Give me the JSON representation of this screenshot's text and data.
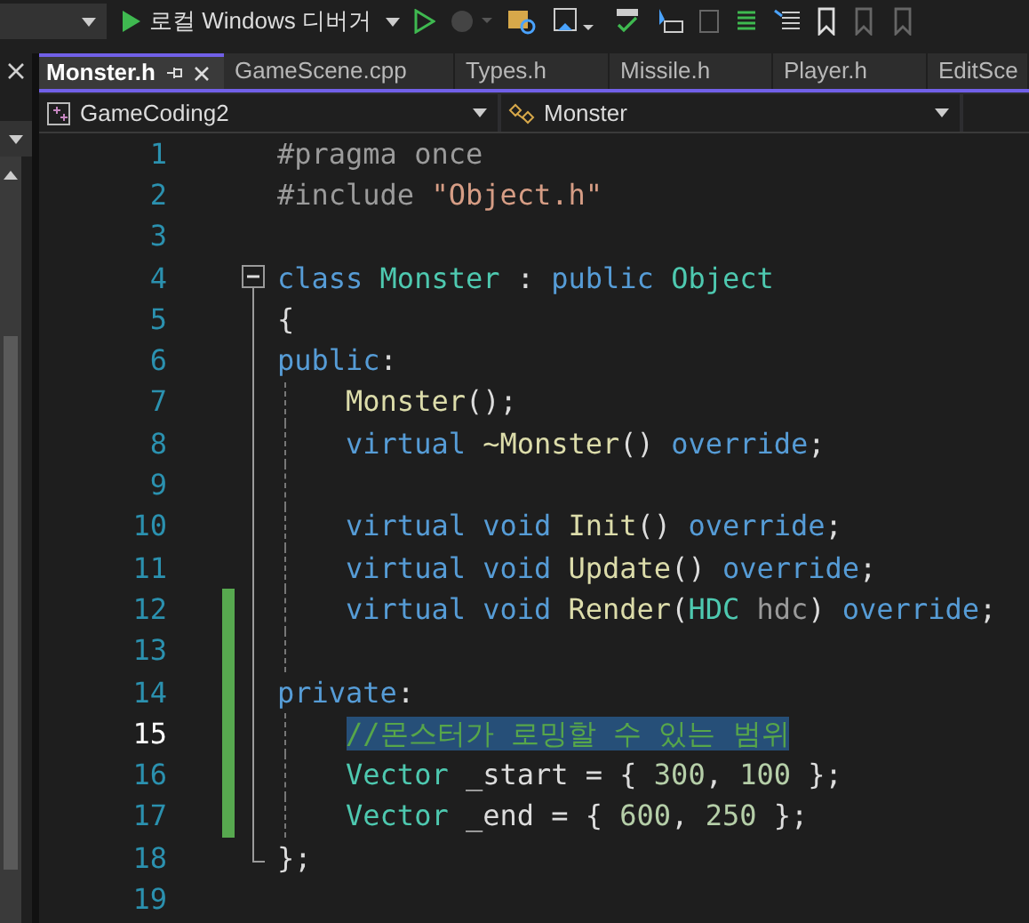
{
  "toolbar": {
    "debugger_label": "로컬 Windows 디버거"
  },
  "tabs": [
    {
      "label": "Monster.h",
      "selected": true
    },
    {
      "label": "GameScene.cpp",
      "selected": false
    },
    {
      "label": "Types.h",
      "selected": false
    },
    {
      "label": "Missile.h",
      "selected": false
    },
    {
      "label": "Player.h",
      "selected": false
    },
    {
      "label": "EditSce",
      "selected": false
    }
  ],
  "navigation": {
    "project": "GameCoding2",
    "scope": "Monster"
  },
  "editor": {
    "lines": [
      {
        "number": "1",
        "tokens": [
          {
            "kind": "preproc",
            "text": "#pragma once"
          }
        ]
      },
      {
        "number": "2",
        "tokens": [
          {
            "kind": "preproc",
            "text": "#include "
          },
          {
            "kind": "string",
            "text": "\"Object.h\""
          }
        ]
      },
      {
        "number": "3"
      },
      {
        "number": "4",
        "fold_expanded": true,
        "tokens": [
          {
            "kind": "keyword",
            "text": "class "
          },
          {
            "kind": "type",
            "text": "Monster"
          },
          {
            "kind": "plain",
            "text": " : "
          },
          {
            "kind": "keyword",
            "text": "public "
          },
          {
            "kind": "type",
            "text": "Object"
          }
        ]
      },
      {
        "number": "5",
        "tokens": [
          {
            "kind": "plain",
            "text": "{"
          }
        ]
      },
      {
        "number": "6",
        "tokens": [
          {
            "kind": "keyword",
            "text": "public"
          },
          {
            "kind": "plain",
            "text": ":"
          }
        ]
      },
      {
        "number": "7",
        "guide": true,
        "tokens": [
          {
            "kind": "function",
            "text": "    Monster"
          },
          {
            "kind": "plain",
            "text": "();"
          }
        ]
      },
      {
        "number": "8",
        "guide": true,
        "tokens": [
          {
            "kind": "keyword",
            "text": "    virtual "
          },
          {
            "kind": "function",
            "text": "~Monster"
          },
          {
            "kind": "plain",
            "text": "() "
          },
          {
            "kind": "keyword",
            "text": "override"
          },
          {
            "kind": "plain",
            "text": ";"
          }
        ]
      },
      {
        "number": "9",
        "guide": true
      },
      {
        "number": "10",
        "guide": true,
        "tokens": [
          {
            "kind": "keyword",
            "text": "    virtual void "
          },
          {
            "kind": "function",
            "text": "Init"
          },
          {
            "kind": "plain",
            "text": "() "
          },
          {
            "kind": "keyword",
            "text": "override"
          },
          {
            "kind": "plain",
            "text": ";"
          }
        ]
      },
      {
        "number": "11",
        "guide": true,
        "tokens": [
          {
            "kind": "keyword",
            "text": "    virtual void "
          },
          {
            "kind": "function",
            "text": "Update"
          },
          {
            "kind": "plain",
            "text": "() "
          },
          {
            "kind": "keyword",
            "text": "override"
          },
          {
            "kind": "plain",
            "text": ";"
          }
        ]
      },
      {
        "number": "12",
        "guide": true,
        "changed": true,
        "tokens": [
          {
            "kind": "keyword",
            "text": "    virtual void "
          },
          {
            "kind": "function",
            "text": "Render"
          },
          {
            "kind": "plain",
            "text": "("
          },
          {
            "kind": "type",
            "text": "HDC"
          },
          {
            "kind": "param",
            "text": " hdc"
          },
          {
            "kind": "plain",
            "text": ") "
          },
          {
            "kind": "keyword",
            "text": "override"
          },
          {
            "kind": "plain",
            "text": ";"
          }
        ]
      },
      {
        "number": "13",
        "guide": true,
        "changed": true
      },
      {
        "number": "14",
        "changed": true,
        "tokens": [
          {
            "kind": "keyword",
            "text": "private"
          },
          {
            "kind": "plain",
            "text": ":"
          }
        ]
      },
      {
        "number": "15",
        "guide": true,
        "changed": true,
        "selected": true,
        "tokens": [
          {
            "kind": "comment",
            "text": "//몬스터가 로밍할 수 있는 범위"
          }
        ]
      },
      {
        "number": "16",
        "guide": true,
        "changed": true,
        "tokens": [
          {
            "kind": "type",
            "text": "    Vector"
          },
          {
            "kind": "plain",
            "text": " _start = { "
          },
          {
            "kind": "number",
            "text": "300"
          },
          {
            "kind": "plain",
            "text": ", "
          },
          {
            "kind": "number",
            "text": "100"
          },
          {
            "kind": "plain",
            "text": " };"
          }
        ]
      },
      {
        "number": "17",
        "guide": true,
        "changed": true,
        "tokens": [
          {
            "kind": "type",
            "text": "    Vector"
          },
          {
            "kind": "plain",
            "text": " _end = { "
          },
          {
            "kind": "number",
            "text": "600"
          },
          {
            "kind": "plain",
            "text": ", "
          },
          {
            "kind": "number",
            "text": "250"
          },
          {
            "kind": "plain",
            "text": " };"
          }
        ]
      },
      {
        "number": "18",
        "fold_end": true,
        "tokens": [
          {
            "kind": "plain",
            "text": "};"
          }
        ]
      },
      {
        "number": "19"
      }
    ]
  }
}
